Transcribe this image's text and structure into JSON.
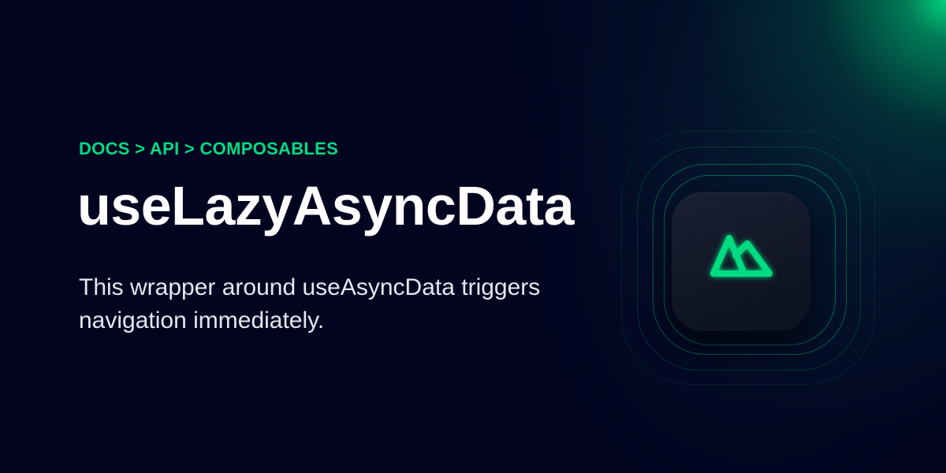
{
  "breadcrumb": "DOCS > API > COMPOSABLES",
  "title": "useLazyAsyncData",
  "description": "This wrapper around useAsyncData triggers navigation immediately.",
  "logo": {
    "icon": "nuxt-logo-icon",
    "color": "#00dc82"
  },
  "colors": {
    "background": "#020420",
    "accent": "#00dc82",
    "title": "#ffffff",
    "body_text": "#e6e7ef"
  }
}
